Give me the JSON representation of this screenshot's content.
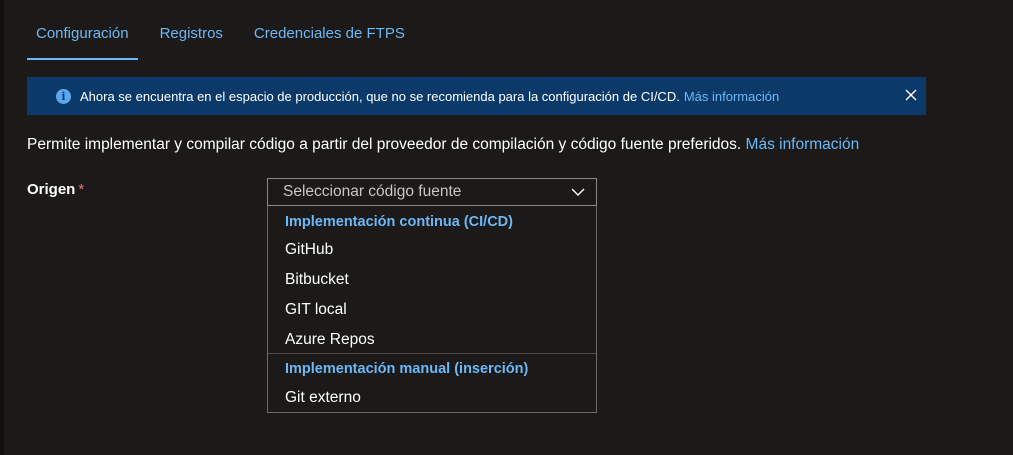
{
  "tabs": [
    {
      "label": "Configuración",
      "active": true
    },
    {
      "label": "Registros",
      "active": false
    },
    {
      "label": "Credenciales de FTPS",
      "active": false
    }
  ],
  "banner": {
    "icon": "info-icon",
    "text": "Ahora se encuentra en el espacio de producción, que no se recomienda para la configuración de CI/CD.",
    "link": "Más información",
    "close_icon": "close-icon"
  },
  "description": {
    "text": "Permite implementar y compilar código a partir del proveedor de compilación y código fuente preferidos.",
    "link": "Más información"
  },
  "origin": {
    "label": "Origen",
    "required_mark": "*",
    "placeholder": "Seleccionar código fuente",
    "groups": [
      {
        "header": "Implementación continua (CI/CD)",
        "items": [
          "GitHub",
          "Bitbucket",
          "GIT local",
          "Azure Repos"
        ]
      },
      {
        "header": "Implementación manual (inserción)",
        "items": [
          "Git externo"
        ]
      }
    ]
  },
  "colors": {
    "background": "#1b1a19",
    "accent": "#6cb8f6",
    "banner_bg": "#0b3a6a",
    "required": "#f1707b"
  }
}
